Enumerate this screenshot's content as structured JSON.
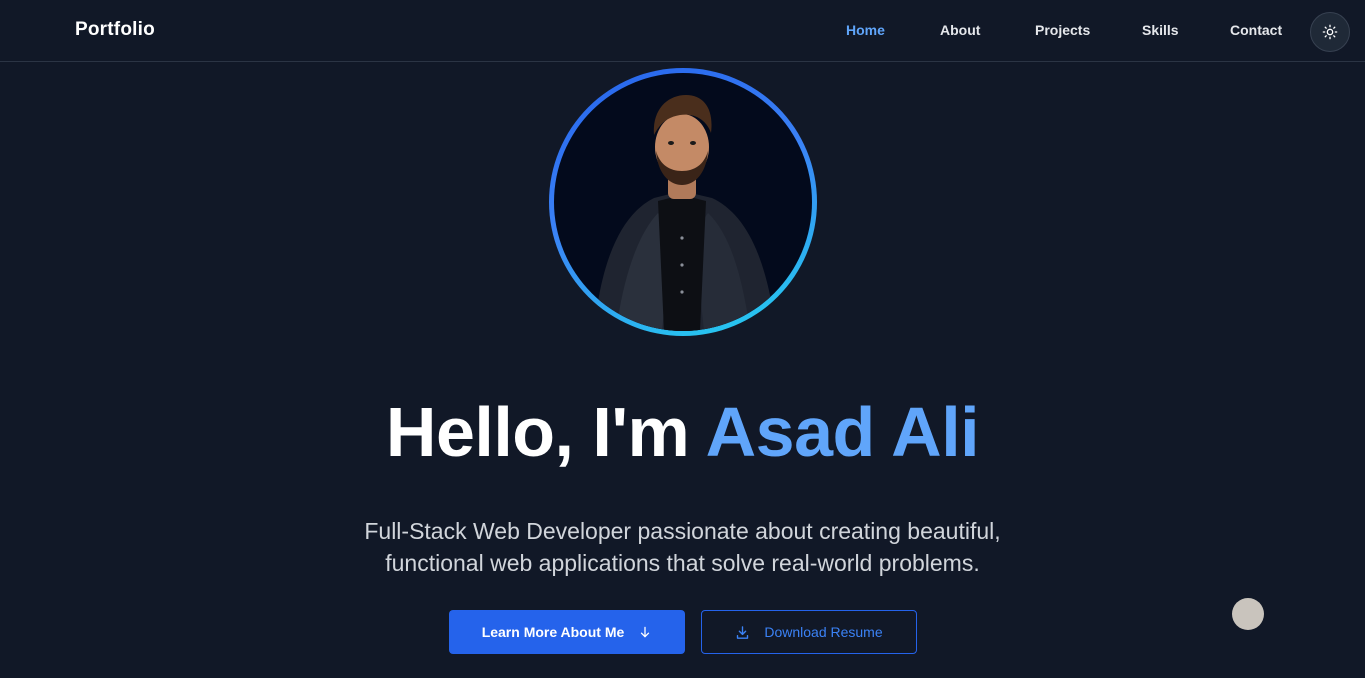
{
  "header": {
    "brand": "Portfolio",
    "nav": [
      {
        "label": "Home",
        "active": true
      },
      {
        "label": "About",
        "active": false
      },
      {
        "label": "Projects",
        "active": false
      },
      {
        "label": "Skills",
        "active": false
      },
      {
        "label": "Contact",
        "active": false
      }
    ],
    "theme_toggle_icon": "sun-icon"
  },
  "hero": {
    "greeting": "Hello, I'm",
    "name": "Asad Ali",
    "subtitle_line1": "Full-Stack Web Developer passionate about creating beautiful,",
    "subtitle_line2": "functional web applications that solve real-world problems.",
    "primary_button": {
      "label": "Learn More About Me",
      "icon": "arrow-down-icon"
    },
    "secondary_button": {
      "label": "Download Resume",
      "icon": "download-icon"
    }
  },
  "colors": {
    "background": "#111827",
    "accent": "#60a5fa",
    "button_primary": "#2563eb"
  }
}
